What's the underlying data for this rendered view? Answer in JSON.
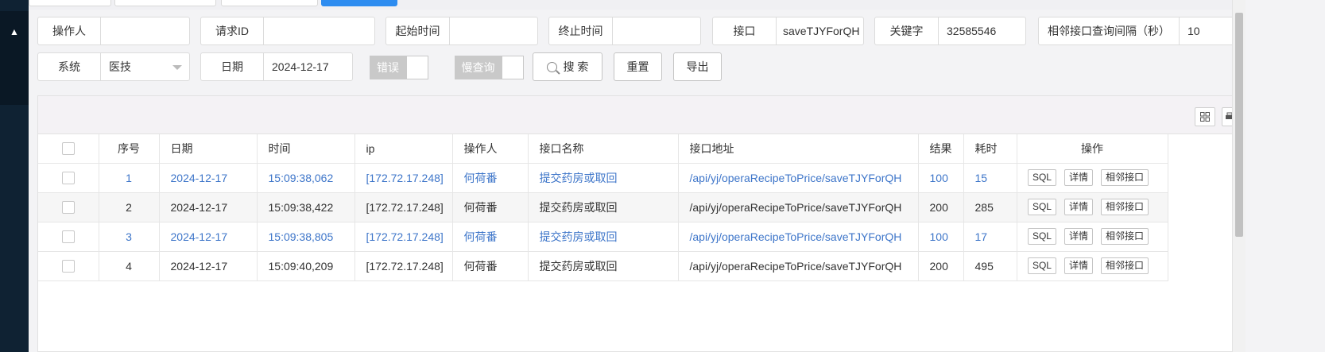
{
  "filters": {
    "operator": {
      "label": "操作人",
      "value": ""
    },
    "request_id": {
      "label": "请求ID",
      "value": ""
    },
    "start_time": {
      "label": "起始时间",
      "value": ""
    },
    "end_time": {
      "label": "终止时间",
      "value": ""
    },
    "api": {
      "label": "接口",
      "value": "saveTJYForQH"
    },
    "keyword": {
      "label": "关键字",
      "value": "32585546"
    },
    "interval": {
      "label": "相邻接口查询间隔（秒）",
      "value": "10"
    },
    "system": {
      "label": "系统",
      "value": "医技"
    },
    "date": {
      "label": "日期",
      "value": "2024-12-17"
    },
    "error_toggle": {
      "label": "错误"
    },
    "slow_query_toggle": {
      "label": "慢查询"
    }
  },
  "buttons": {
    "search": "搜 索",
    "reset": "重置",
    "export": "导出"
  },
  "table": {
    "columns": [
      "序号",
      "日期",
      "时间",
      "ip",
      "操作人",
      "接口名称",
      "接口地址",
      "结果",
      "耗时",
      "操作"
    ],
    "row_actions": [
      "SQL",
      "详情",
      "相邻接口"
    ],
    "rows": [
      {
        "no": "1",
        "date": "2024-12-17",
        "time": "15:09:38,062",
        "ip": "[172.72.17.248]",
        "operator": "何荷番",
        "api_name": "提交药房或取回",
        "api_path": "/api/yj/operaRecipeToPrice/saveTJYForQH",
        "result": "100",
        "cost": "15"
      },
      {
        "no": "2",
        "date": "2024-12-17",
        "time": "15:09:38,422",
        "ip": "[172.72.17.248]",
        "operator": "何荷番",
        "api_name": "提交药房或取回",
        "api_path": "/api/yj/operaRecipeToPrice/saveTJYForQH",
        "result": "200",
        "cost": "285"
      },
      {
        "no": "3",
        "date": "2024-12-17",
        "time": "15:09:38,805",
        "ip": "[172.72.17.248]",
        "operator": "何荷番",
        "api_name": "提交药房或取回",
        "api_path": "/api/yj/operaRecipeToPrice/saveTJYForQH",
        "result": "100",
        "cost": "17"
      },
      {
        "no": "4",
        "date": "2024-12-17",
        "time": "15:09:40,209",
        "ip": "[172.72.17.248]",
        "operator": "何荷番",
        "api_name": "提交药房或取回",
        "api_path": "/api/yj/operaRecipeToPrice/saveTJYForQH",
        "result": "200",
        "cost": "495"
      }
    ]
  },
  "colors": {
    "link_blue": "#3d75c9",
    "accent_blue": "#2d8cf0",
    "sidebar_dark": "#0f2233"
  }
}
